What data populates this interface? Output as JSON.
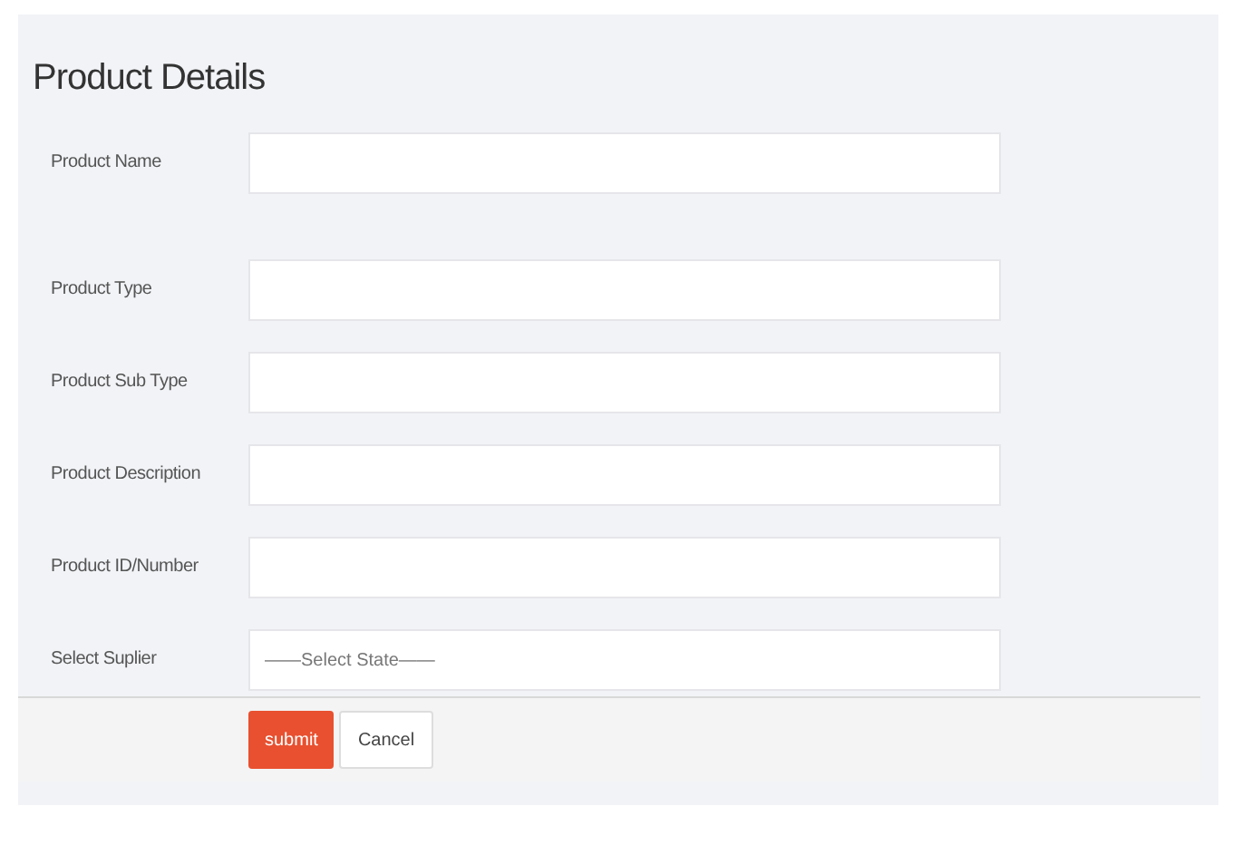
{
  "title": "Product Details",
  "fields": [
    {
      "label": "Product Name",
      "kind": "text"
    },
    {
      "label": "Product Type",
      "kind": "text"
    },
    {
      "label": "Product Sub Type",
      "kind": "text"
    },
    {
      "label": "Product Description",
      "kind": "text"
    },
    {
      "label": "Product ID/Number",
      "kind": "text"
    },
    {
      "label": "Select Suplier",
      "kind": "select",
      "value": "——Select State——"
    }
  ],
  "buttons": [
    {
      "label": "submit",
      "kind": "primary"
    },
    {
      "label": "Cancel",
      "kind": "default"
    }
  ]
}
